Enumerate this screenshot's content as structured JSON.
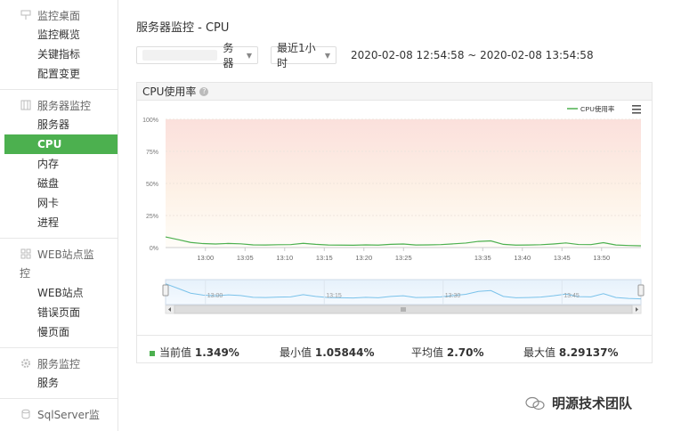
{
  "sidebar": {
    "groups": [
      {
        "title": "监控桌面",
        "icon": "pin-icon",
        "items": [
          "监控概览",
          "关键指标",
          "配置变更"
        ]
      },
      {
        "title": "服务器监控",
        "icon": "server-icon",
        "items": [
          "服务器",
          "CPU",
          "内存",
          "磁盘",
          "网卡",
          "进程"
        ],
        "active": "CPU"
      },
      {
        "title_line1": "WEB站点监",
        "title_line2": "控",
        "icon": "grid-icon",
        "items": [
          "WEB站点",
          "错误页面",
          "慢页面"
        ]
      },
      {
        "title": "服务监控",
        "icon": "gear-icon",
        "items": [
          "服务"
        ]
      },
      {
        "title": "SqlServer监",
        "icon": "database-icon",
        "items": []
      }
    ]
  },
  "page": {
    "title": "服务器监控 - CPU",
    "server_select_suffix": "务器",
    "time_select": "最近1小时",
    "time_range": "2020-02-08 12:54:58 ~ 2020-02-08 13:54:58"
  },
  "panel": {
    "title": "CPU使用率",
    "menu_icon": "hamburger-icon"
  },
  "chart_data": {
    "type": "line",
    "title": "",
    "legend": "CPU使用率",
    "legend_position": "top-right",
    "y_ticks": [
      "0%",
      "25%",
      "50%",
      "75%",
      "100%"
    ],
    "ylim": [
      0,
      100
    ],
    "x_ticks": [
      "13:00",
      "13:05",
      "13:10",
      "13:15",
      "13:20",
      "13:25",
      "13:35",
      "13:40",
      "13:45",
      "13:50"
    ],
    "navigator_ticks": [
      "13:00",
      "13:15",
      "13:30",
      "13:45"
    ],
    "series": [
      {
        "name": "CPU使用率",
        "color": "#4cb04f",
        "values": [
          8.3,
          6.2,
          4.0,
          3.1,
          2.8,
          3.2,
          2.9,
          2.1,
          2.0,
          2.2,
          2.3,
          3.3,
          2.5,
          2.0,
          1.9,
          1.8,
          2.1,
          1.9,
          2.5,
          2.8,
          2.0,
          2.1,
          2.3,
          2.9,
          3.5,
          4.8,
          5.2,
          2.5,
          1.9,
          2.0,
          2.2,
          2.8,
          3.6,
          2.4,
          2.3,
          3.8,
          2.0,
          1.6,
          1.4
        ]
      }
    ]
  },
  "stats": {
    "current_label": "当前值",
    "current_value": "1.349%",
    "min_label": "最小值",
    "min_value": "1.05844%",
    "avg_label": "平均值",
    "avg_value": "2.70%",
    "max_label": "最大值",
    "max_value": "8.29137%"
  },
  "watermark": "明源技术团队"
}
